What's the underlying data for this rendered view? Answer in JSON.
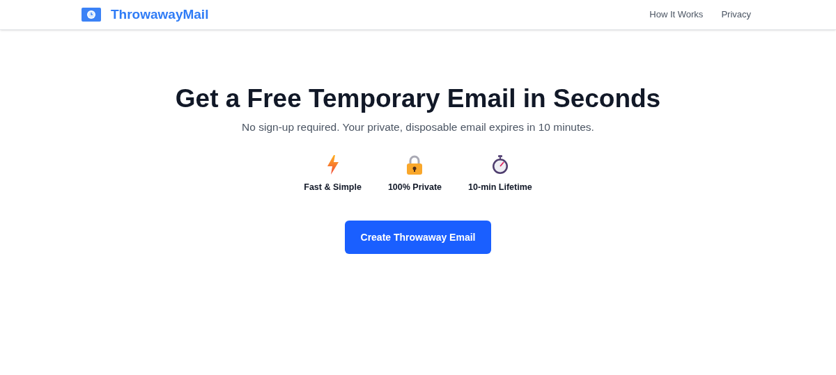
{
  "header": {
    "brand": "ThrowawayMail",
    "nav": [
      "How It Works",
      "Privacy"
    ]
  },
  "hero": {
    "title": "Get a Free Temporary Email in Seconds",
    "subtitle": "No sign-up required. Your private, disposable email expires in 10 minutes.",
    "features": [
      {
        "kind": "bolt",
        "label": "Fast & Simple"
      },
      {
        "kind": "lock",
        "label": "100% Private"
      },
      {
        "kind": "stopwatch",
        "label": "10-min Lifetime"
      }
    ],
    "button": "Create Throwaway Email"
  }
}
